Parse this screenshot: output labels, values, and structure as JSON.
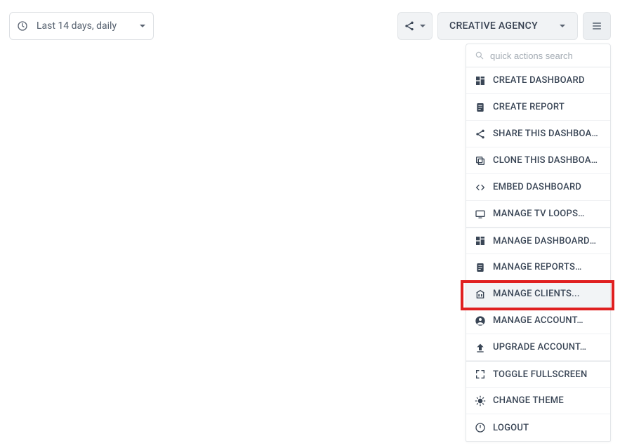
{
  "topbar": {
    "date_range_label": "Last 14 days, daily",
    "client_selector_label": "CREATIVE AGENCY"
  },
  "dropdown": {
    "search_placeholder": "quick actions search",
    "items": [
      {
        "icon": "dashboard",
        "label": "CREATE DASHBOARD"
      },
      {
        "icon": "report",
        "label": "CREATE REPORT"
      },
      {
        "icon": "share",
        "label": "SHARE THIS DASHBOARD"
      },
      {
        "icon": "clone",
        "label": "CLONE THIS DASHBOARD"
      },
      {
        "icon": "embed",
        "label": "EMBED DASHBOARD"
      },
      {
        "icon": "tv",
        "label": "MANAGE TV LOOPS…"
      },
      {
        "icon": "dashboard",
        "label": "MANAGE DASHBOARDS..."
      },
      {
        "icon": "report",
        "label": "MANAGE REPORTS…"
      },
      {
        "icon": "clients",
        "label": "MANAGE CLIENTS..."
      },
      {
        "icon": "account",
        "label": "MANAGE ACCOUNT…"
      },
      {
        "icon": "upgrade",
        "label": "UPGRADE ACCOUNT…"
      },
      {
        "icon": "fullscreen",
        "label": "TOGGLE FULLSCREEN"
      },
      {
        "icon": "theme",
        "label": "CHANGE THEME"
      },
      {
        "icon": "logout",
        "label": "LOGOUT"
      }
    ]
  }
}
